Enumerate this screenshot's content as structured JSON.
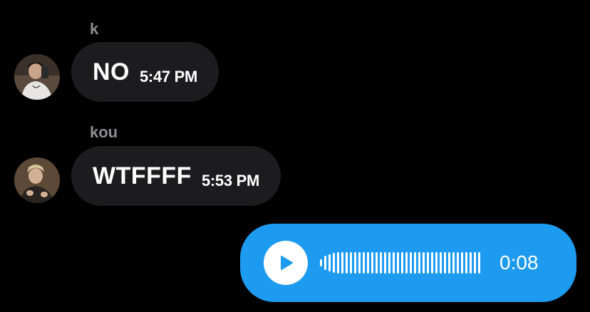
{
  "messages": [
    {
      "sender": "k",
      "text": "NO",
      "time": "5:47 PM",
      "avatar_icon": "user-avatar-photo"
    },
    {
      "sender": "kou",
      "text": "WTFFFF",
      "time": "5:53 PM",
      "avatar_icon": "user-avatar-photo"
    }
  ],
  "voice_message": {
    "duration": "0:08",
    "play_icon": "play-icon",
    "bubble_color": "#1d9bf0",
    "accent_color": "#1d9bf0"
  },
  "colors": {
    "background": "#000000",
    "incoming_bubble": "#1c1c1e",
    "sender_name": "#8e8e93",
    "text": "#ffffff"
  }
}
